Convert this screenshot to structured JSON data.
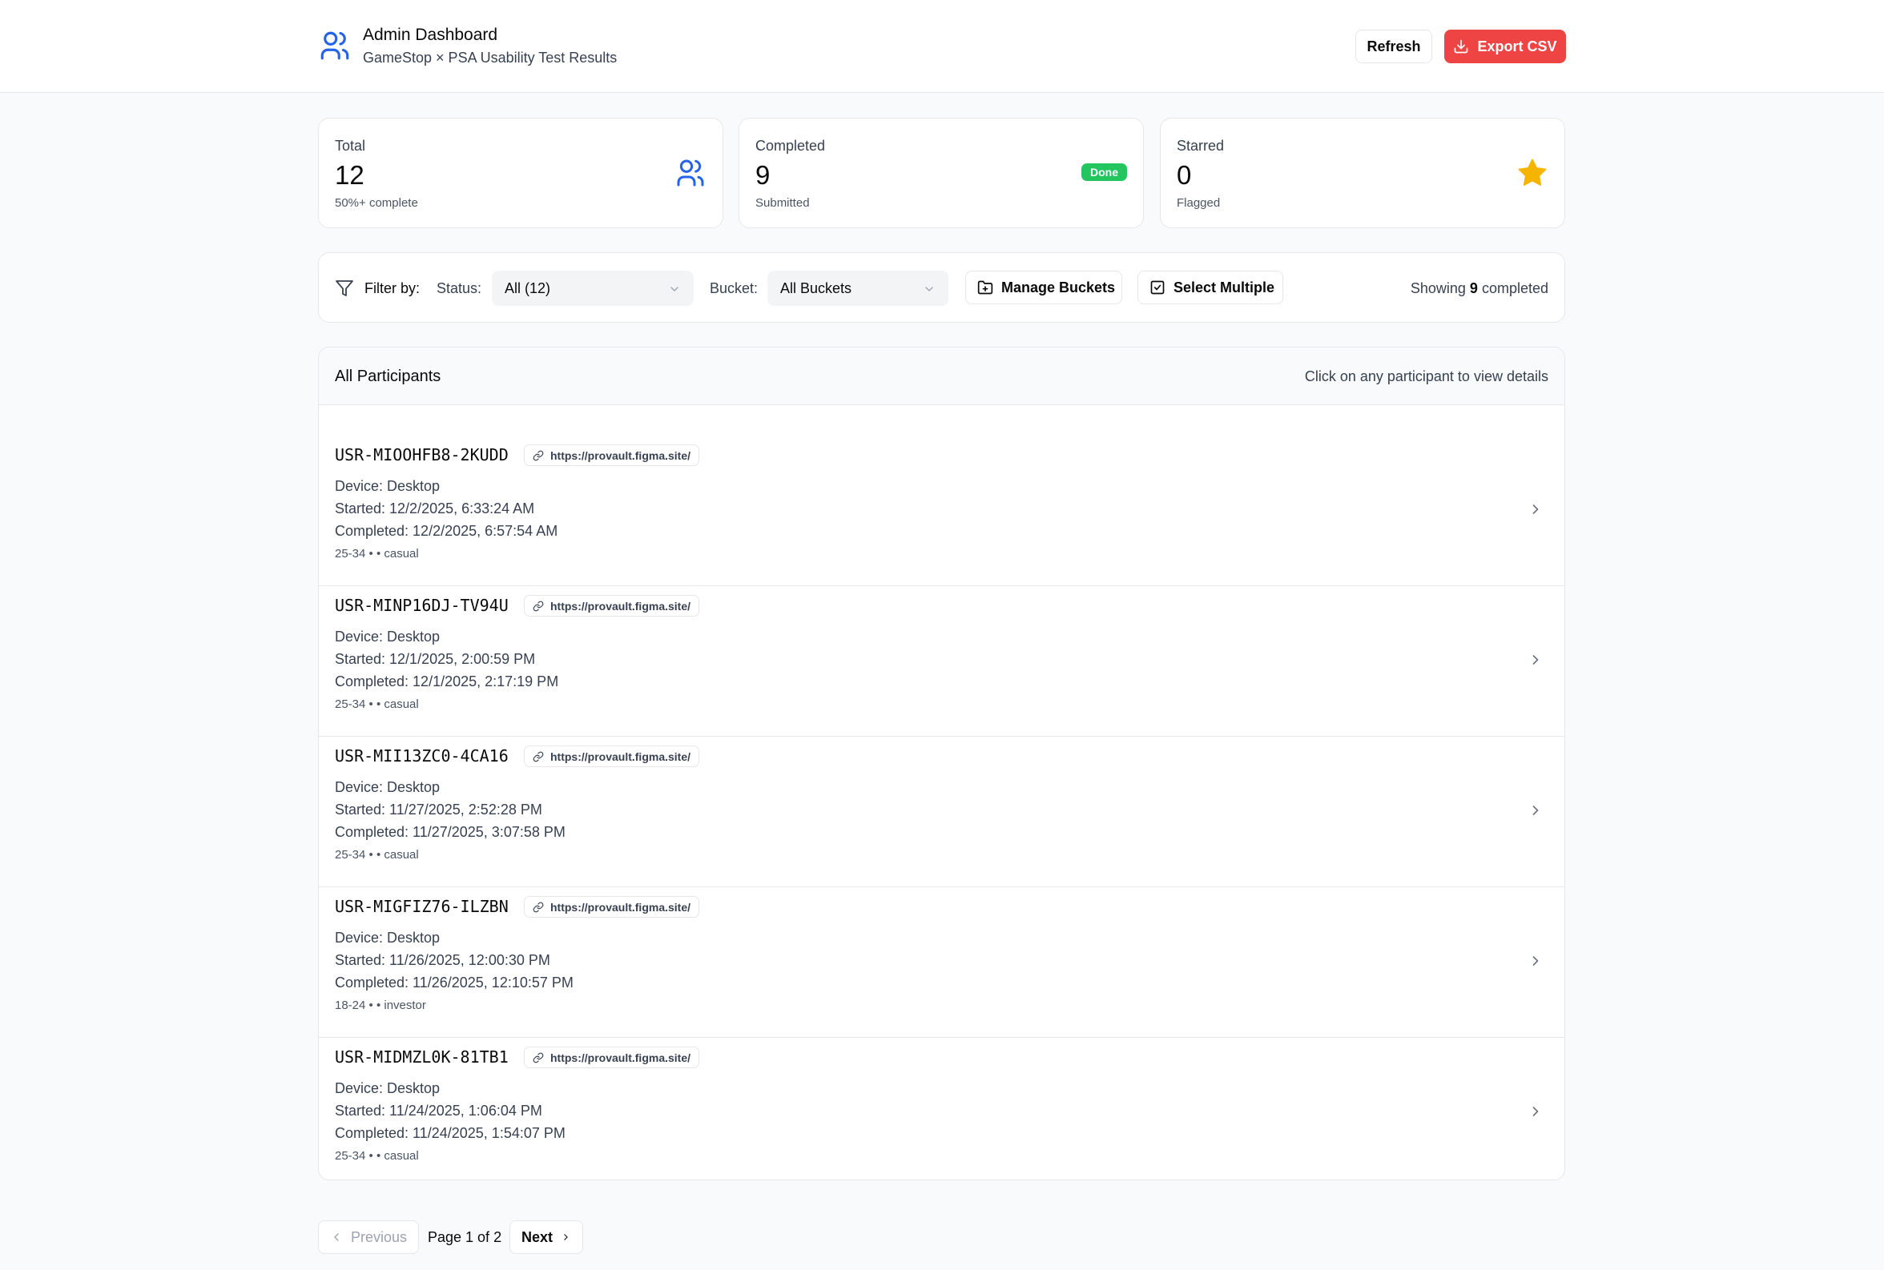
{
  "header": {
    "title": "Admin Dashboard",
    "subtitle": "GameStop × PSA Usability Test Results",
    "logo_icon": "users-icon",
    "refresh_label": "Refresh",
    "export_label": "Export CSV"
  },
  "stats": [
    {
      "label": "Total",
      "value": "12",
      "sub": "50%+ complete",
      "icon": "users-icon"
    },
    {
      "label": "Completed",
      "value": "9",
      "sub": "Submitted",
      "badge": "Done"
    },
    {
      "label": "Starred",
      "value": "0",
      "sub": "Flagged",
      "icon": "star-icon"
    }
  ],
  "filters": {
    "filter_label": "Filter by:",
    "status_label": "Status:",
    "status_value": "All (12)",
    "bucket_label": "Bucket:",
    "bucket_value": "All Buckets",
    "manage_buckets_label": "Manage Buckets",
    "select_multiple_label": "Select Multiple",
    "showing_prefix": "Showing",
    "showing_count": "9",
    "showing_suffix": "completed"
  },
  "list": {
    "title": "All Participants",
    "hint": "Click on any participant to view details",
    "participants": [
      {
        "id": "USR-MIOOHFB8-2KUDD",
        "url": "https://provault.figma.site/",
        "device": "Device: Desktop",
        "started": "Started: 12/2/2025, 6:33:24 AM",
        "completed": "Completed: 12/2/2025, 6:57:54 AM",
        "meta": "25-34 • • casual"
      },
      {
        "id": "USR-MINP16DJ-TV94U",
        "url": "https://provault.figma.site/",
        "device": "Device: Desktop",
        "started": "Started: 12/1/2025, 2:00:59 PM",
        "completed": "Completed: 12/1/2025, 2:17:19 PM",
        "meta": "25-34 • • casual"
      },
      {
        "id": "USR-MII13ZC0-4CA16",
        "url": "https://provault.figma.site/",
        "device": "Device: Desktop",
        "started": "Started: 11/27/2025, 2:52:28 PM",
        "completed": "Completed: 11/27/2025, 3:07:58 PM",
        "meta": "25-34 • • casual"
      },
      {
        "id": "USR-MIGFIZ76-ILZBN",
        "url": "https://provault.figma.site/",
        "device": "Device: Desktop",
        "started": "Started: 11/26/2025, 12:00:30 PM",
        "completed": "Completed: 11/26/2025, 12:10:57 PM",
        "meta": "18-24 • • investor"
      },
      {
        "id": "USR-MIDMZL0K-81TB1",
        "url": "https://provault.figma.site/",
        "device": "Device: Desktop",
        "started": "Started: 11/24/2025, 1:06:04 PM",
        "completed": "Completed: 11/24/2025, 1:54:07 PM",
        "meta": "25-34 • • casual"
      }
    ]
  },
  "pagination": {
    "previous_label": "Previous",
    "page_text": "Page 1 of 2",
    "next_label": "Next"
  },
  "colors": {
    "accent_blue": "#2563eb",
    "export_red": "#ef4444",
    "done_green": "#22c55e",
    "star_yellow": "#f5b400"
  }
}
